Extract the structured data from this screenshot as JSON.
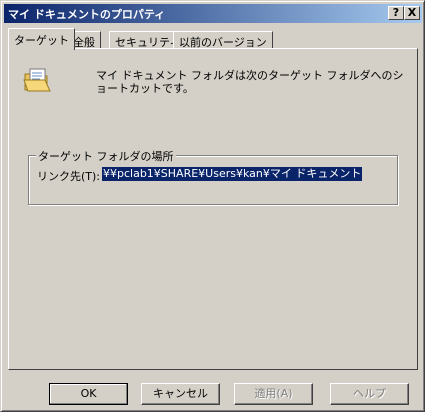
{
  "window": {
    "title": "マイ ドキュメントのプロパティ",
    "help_button": "?",
    "close_button": "X"
  },
  "tabs": [
    {
      "label": "ターゲット",
      "active": true
    },
    {
      "label": "全般",
      "active": false
    },
    {
      "label": "セキュリティ",
      "active": false
    },
    {
      "label": "以前のバージョン",
      "active": false
    }
  ],
  "content": {
    "icon": "folder-open-icon",
    "description": "マイ ドキュメント フォルダは次のターゲット フォルダへのショートカットです。",
    "group_title": "ターゲット フォルダの場所",
    "link_label": "リンク先(T):",
    "link_value": "¥¥pclab1¥SHARE¥Users¥kan¥マイ ドキュメント"
  },
  "buttons": {
    "ok": "OK",
    "cancel": "キャンセル",
    "apply": "適用(A)",
    "help": "ヘルプ"
  },
  "colors": {
    "title_gradient_start": "#0a246a",
    "title_gradient_end": "#a6caf0",
    "face": "#d4d0c8",
    "selection": "#0a246a"
  }
}
